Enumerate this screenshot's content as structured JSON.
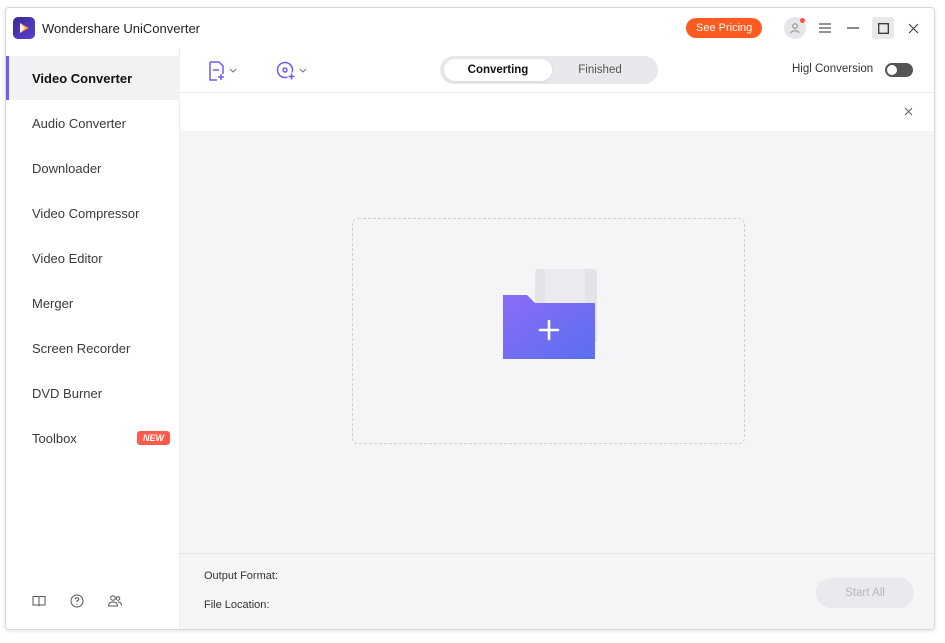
{
  "app": {
    "title": "Wondershare UniConverter",
    "see_pricing": "See Pricing"
  },
  "sidebar": {
    "items": [
      {
        "label": "Video Converter",
        "active": true
      },
      {
        "label": "Audio Converter"
      },
      {
        "label": "Downloader"
      },
      {
        "label": "Video Compressor"
      },
      {
        "label": "Video Editor"
      },
      {
        "label": "Merger"
      },
      {
        "label": "Screen Recorder"
      },
      {
        "label": "DVD Burner"
      },
      {
        "label": "Toolbox",
        "badge": "NEW"
      }
    ],
    "footer_icons": [
      "book-icon",
      "help-icon",
      "community-icon"
    ]
  },
  "toolbar": {
    "tabs": [
      {
        "label": "Converting",
        "active": true
      },
      {
        "label": "Finished"
      }
    ],
    "high_speed_label": "Higl Conversion",
    "high_speed_enabled": false
  },
  "bottom": {
    "output_format_label": "Output Format:",
    "file_location_label": "File Location:",
    "start_all_label": "Start All"
  },
  "colors": {
    "accent": "#6f5cf2",
    "pricing": "#ff5a1f",
    "badge": "#ff5a4a"
  }
}
